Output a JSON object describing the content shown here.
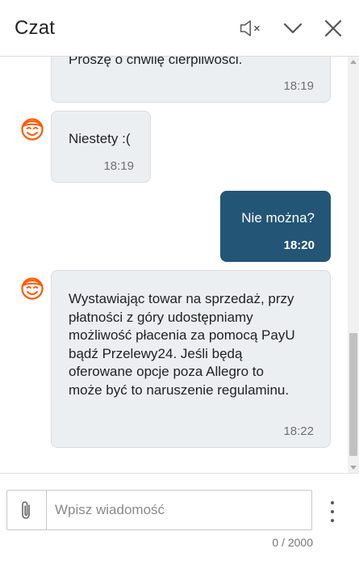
{
  "header": {
    "title": "Czat"
  },
  "messages": [
    {
      "direction": "in",
      "text": "Proszę o chwilę cierpliwości.",
      "time": "18:19"
    },
    {
      "direction": "in",
      "text": "Niestety :(",
      "time": "18:19"
    },
    {
      "direction": "out",
      "text": "Nie można?",
      "time": "18:20"
    },
    {
      "direction": "in",
      "text_lines": [
        "Wystawiając towar na sprzedaż, przy",
        "płatności z góry udostępniamy",
        "możliwość płacenia za pomocą PayU",
        "bądź Przelewy24. Jeśli będą",
        "oferowane opcje poza Allegro to",
        "może być to naruszenie regulaminu."
      ],
      "time": "18:22"
    }
  ],
  "composer": {
    "placeholder": "Wpisz wiadomość",
    "value": "",
    "counter": "0 / 2000"
  },
  "icons": {
    "mute": "speaker-muted-icon",
    "collapse": "chevron-down-icon",
    "close": "close-icon",
    "avatar": "smiley-face-icon",
    "attach": "paperclip-icon",
    "more": "more-vertical-icon"
  },
  "colors": {
    "accent": "#235576",
    "avatar": "#ff5a00",
    "incoming_bubble": "#eceff2"
  }
}
